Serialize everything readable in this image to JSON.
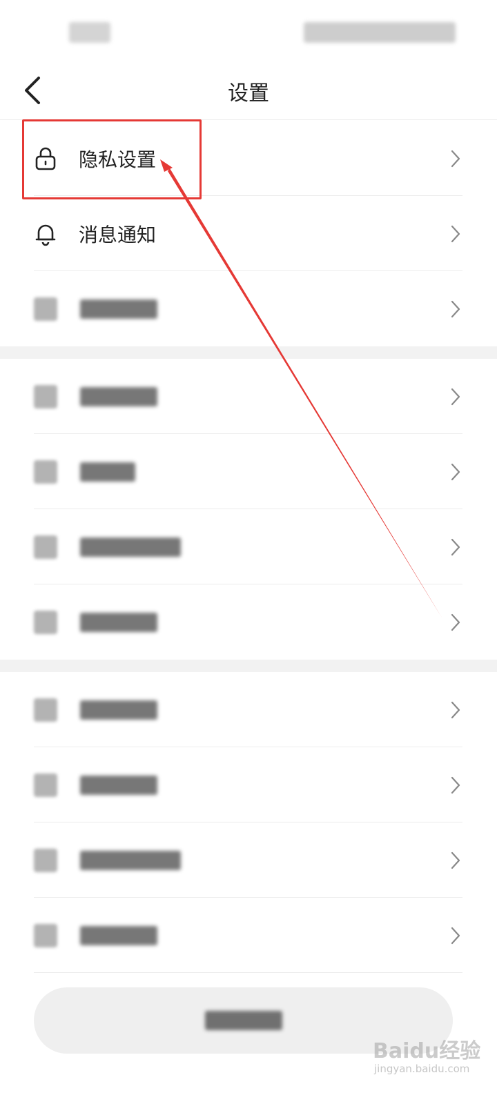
{
  "header": {
    "title": "设置"
  },
  "groups": [
    {
      "items": [
        {
          "label": "隐私设置",
          "icon": "lock-icon"
        },
        {
          "label": "消息通知",
          "icon": "bell-icon"
        },
        {
          "label": "",
          "icon": "blurred-icon"
        }
      ]
    },
    {
      "items": [
        {
          "label": "",
          "icon": "blurred-icon"
        },
        {
          "label": "",
          "icon": "blurred-icon"
        },
        {
          "label": "",
          "icon": "blurred-icon"
        },
        {
          "label": "",
          "icon": "blurred-icon"
        }
      ]
    },
    {
      "items": [
        {
          "label": "",
          "icon": "blurred-icon"
        },
        {
          "label": "",
          "icon": "blurred-icon"
        },
        {
          "label": "",
          "icon": "blurred-icon"
        },
        {
          "label": "",
          "icon": "blurred-icon"
        }
      ]
    }
  ],
  "colors": {
    "annotation": "#e53935",
    "separator": "#f2f2f2"
  },
  "watermark": {
    "text": "Baidu经验",
    "sub": "jingyan.baidu.com"
  }
}
